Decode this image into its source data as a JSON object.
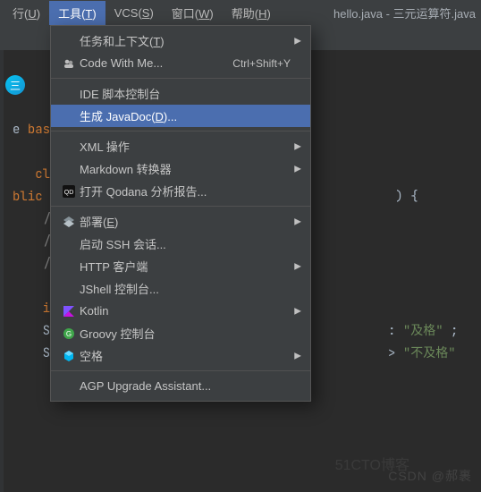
{
  "menubar": {
    "run": {
      "pre": "行(",
      "u": "U",
      "post": ")"
    },
    "tools": {
      "pre": "工具(",
      "u": "T",
      "post": ")"
    },
    "vcs": {
      "pre": "VCS(",
      "u": "S",
      "post": ")"
    },
    "window": {
      "pre": "窗口(",
      "u": "W",
      "post": ")"
    },
    "help": {
      "pre": "帮助(",
      "u": "H",
      "post": ")"
    },
    "title_right": "hello.java - 三元运算符.java"
  },
  "logo": "三",
  "code": {
    "l1_pre": "e ",
    "l1_kw": "bas",
    "l2_kw": "clas",
    "l3a": "blic",
    "l3b": " ",
    "l3c": ") {",
    "l4": "//三",
    "l5": "//x",
    "l6": "//如",
    "l7a": "int",
    "l8a": "Str",
    "l8b": ": ",
    "l8c": "\"及格\"",
    "l8d": " ;",
    "l9a": "Sys",
    "l9b": "> ",
    "l9c": "\"不及格\""
  },
  "dd": {
    "tasks": {
      "pre": "任务和上下文(",
      "u": "T",
      "post": ")"
    },
    "cwm": "Code With Me...",
    "cwm_short": "Ctrl+Shift+Y",
    "ide_script": "IDE 脚本控制台",
    "javadoc": {
      "pre": "生成 JavaDoc(",
      "u": "D",
      "post": ")..."
    },
    "xml": "XML 操作",
    "md": "Markdown 转换器",
    "qodana": "打开 Qodana 分析报告...",
    "deploy": {
      "pre": "部署(",
      "u": "E",
      "post": ")"
    },
    "ssh": "启动 SSH 会话...",
    "http": "HTTP 客户端",
    "jshell": "JShell 控制台...",
    "kotlin": "Kotlin",
    "groovy": "Groovy 控制台",
    "space": "空格",
    "agp": "AGP Upgrade Assistant..."
  },
  "watermark1": "CSDN @郝裹",
  "watermark2": "51CTO博客"
}
